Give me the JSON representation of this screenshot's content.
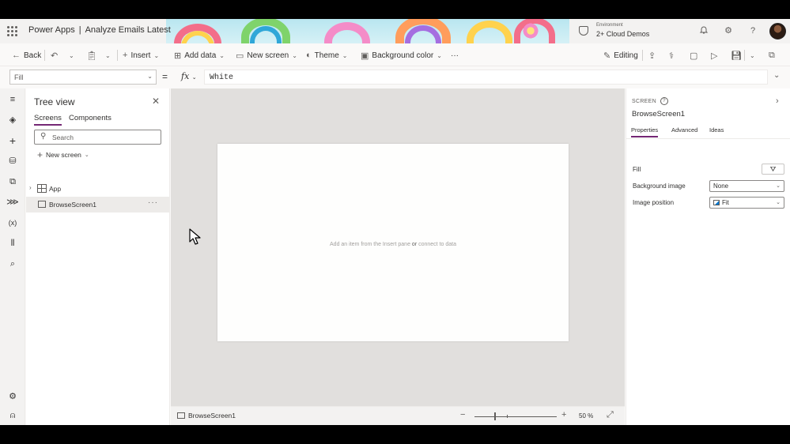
{
  "header": {
    "app_name": "Power Apps",
    "separator": "|",
    "document_name": "Analyze Emails Latest",
    "environment_label": "Environment",
    "environment_name": "2+ Cloud Demos",
    "icons": [
      "waffle-icon",
      "environment-icon",
      "bell-icon",
      "gear-icon",
      "help-icon",
      "avatar"
    ]
  },
  "commandbar": {
    "back": "Back",
    "insert": "Insert",
    "add_data": "Add data",
    "new_screen": "New screen",
    "theme": "Theme",
    "background_color": "Background color",
    "more": "···",
    "editing": "Editing"
  },
  "formulabar": {
    "property": "Fill",
    "equals": "=",
    "fx": "fx",
    "formula": "White"
  },
  "tree": {
    "title": "Tree view",
    "tabs": [
      "Screens",
      "Components"
    ],
    "search_placeholder": "Search",
    "new_screen": "New screen",
    "items": [
      {
        "label": "App"
      },
      {
        "label": "BrowseScreen1",
        "more": "···"
      }
    ]
  },
  "canvas": {
    "hint_part1": "Add an item from the Insert pane",
    "hint_or": "or",
    "hint_part2": "connect to data"
  },
  "statusbar": {
    "screen_name": "BrowseScreen1",
    "zoom_minus": "−",
    "zoom_plus": "+",
    "zoom_value": "50 %",
    "zoom_level_percent": 50
  },
  "properties": {
    "kind": "SCREEN",
    "help": "?",
    "name": "BrowseScreen1",
    "tabs": [
      "Properties",
      "Advanced",
      "Ideas"
    ],
    "fill_label": "Fill",
    "background_image_label": "Background image",
    "background_image_value": "None",
    "image_position_label": "Image position",
    "image_position_value": "Fit"
  },
  "colors": {
    "accent": "#742774",
    "canvas_bg": "#e1dfdd",
    "screen_fill": "#fefefd"
  }
}
